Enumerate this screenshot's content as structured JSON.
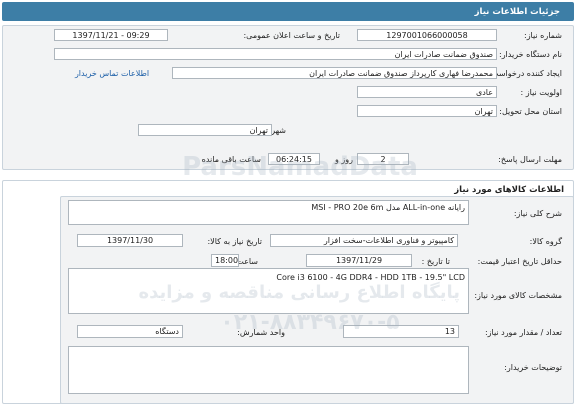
{
  "header": {
    "title": "جزئیات اطلاعات نیاز"
  },
  "info": {
    "need_number_label": "شماره نیاز:",
    "need_number": "1297001066000058",
    "announce_label": "تاریخ و ساعت اعلان عمومی:",
    "announce_value": "1397/11/21 - 09:29",
    "buyer_label": "نام دستگاه خریدار:",
    "buyer_value": "صندوق ضمانت صادرات ایران",
    "creator_label": "ایجاد کننده درخواست:",
    "creator_value": "محمدرضا فهاری کارپرداز صندوق ضمانت صادرات ایران",
    "contact_link": "اطلاعات تماس خریدار",
    "priority_label": "اولویت نیاز :",
    "priority_value": "عادی",
    "province_label": "استان محل تحویل:",
    "province_value": "تهران",
    "city_label": "شهر محل تحویل:",
    "city_value": "تهران",
    "deadline_label": "مهلت ارسال پاسخ:",
    "deadline_days": "2",
    "day_and": "روز و",
    "deadline_time": "06:24:15",
    "remaining": "ساعت باقی مانده"
  },
  "goods": {
    "section_title": "اطلاعات کالاهای مورد نیاز",
    "summary_label": "شرح کلی نیاز:",
    "summary_value": "رایانه ALL-in-one مدل MSI - PRO 20e 6m",
    "group_label": "گروه کالا:",
    "group_value": "کامپیوتر و فناوری اطلاعات-سخت افزار",
    "need_date_label": "تاریخ نیاز به کالا:",
    "need_date_value": "1397/11/30",
    "min_validity_label": "حداقل تاریخ اعتبار قیمت:",
    "until_date_label": "تا تاریخ :",
    "until_date_value": "1397/11/29",
    "hour_label": "ساعت :",
    "hour_value": "18:00",
    "spec_label": "مشخصات کالای مورد نیاز:",
    "spec_value": "Core i3 6100 - 4G DDR4 - HDD 1TB - 19.5\" LCD",
    "qty_label": "تعداد / مقدار مورد نیاز:",
    "qty_value": "13",
    "unit_label": "واحد شمارش:",
    "unit_value": "دستگاه",
    "buyer_notes_label": "توضیحات خریدار:",
    "buyer_notes_value": ""
  },
  "watermark": {
    "line1": "ParsNamadData",
    "line2": "پایگاه اطلاع رسانی مناقصه و مزایده",
    "line3": "۰۲۱-۸۸۳۴۹۶۷۰-۵"
  }
}
